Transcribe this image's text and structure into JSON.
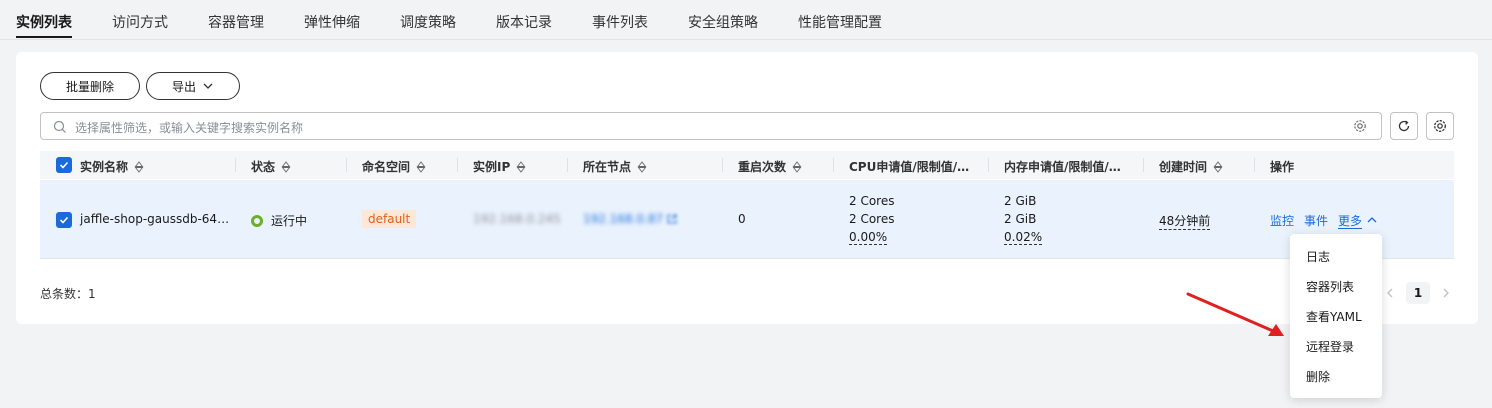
{
  "tabs": [
    "实例列表",
    "访问方式",
    "容器管理",
    "弹性伸缩",
    "调度策略",
    "版本记录",
    "事件列表",
    "安全组策略",
    "性能管理配置"
  ],
  "toolbar": {
    "batch_delete": "批量删除",
    "export": "导出"
  },
  "search": {
    "placeholder": "选择属性筛选，或输入关键字搜索实例名称"
  },
  "table": {
    "columns": [
      "实例名称",
      "状态",
      "命名空间",
      "实例IP",
      "所在节点",
      "重启次数",
      "CPU申请值/限制值/…",
      "内存申请值/限制值/…",
      "创建时间",
      "操作"
    ],
    "row": {
      "name": "jaffle-shop-gaussdb-64…",
      "status": "运行中",
      "namespace": "default",
      "ip": "192.168.0.245",
      "node": "192.168.0.87",
      "restarts": "0",
      "cpu_request": "2 Cores",
      "cpu_limit": "2 Cores",
      "cpu_usage": "0.00%",
      "mem_request": "2 GiB",
      "mem_limit": "2 GiB",
      "mem_usage": "0.02%",
      "created": "48分钟前",
      "actions": {
        "monitor": "监控",
        "events": "事件",
        "more": "更多"
      }
    }
  },
  "footer": {
    "total": "总条数：1",
    "page": "1"
  },
  "more_menu": [
    "日志",
    "容器列表",
    "查看YAML",
    "远程登录",
    "删除"
  ],
  "colors": {
    "primary": "#1a6bd9",
    "running": "#6dae2c",
    "namespace_tag_bg": "#fde7d6",
    "namespace_tag_text": "#e0601a",
    "annotation_arrow": "#e02020"
  },
  "icons": [
    "search-icon",
    "settings-icon",
    "refresh-icon",
    "sort-icon",
    "chevron-down-icon",
    "chevron-up-icon",
    "external-link-icon",
    "chevron-left-icon",
    "chevron-right-icon",
    "checkbox-checked-icon"
  ]
}
